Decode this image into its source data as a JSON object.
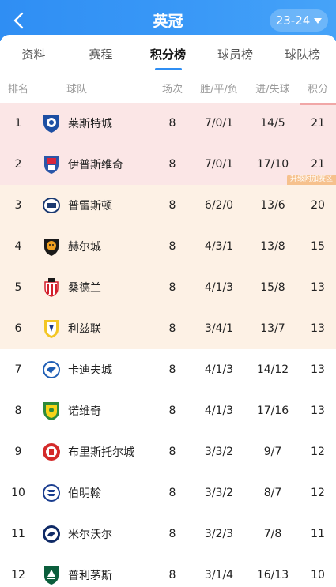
{
  "header": {
    "title": "英冠",
    "season": "23-24"
  },
  "tabs": [
    {
      "label": "资料"
    },
    {
      "label": "赛程"
    },
    {
      "label": "积分榜"
    },
    {
      "label": "球员榜"
    },
    {
      "label": "球队榜"
    }
  ],
  "active_tab": "积分榜",
  "columns": {
    "rank": "排名",
    "team": "球队",
    "played": "场次",
    "wdl": "胜/平/负",
    "goals": "进/失球",
    "points": "积分"
  },
  "zone_label": "升级附加赛区",
  "colors": {
    "header": "#2f8ef3",
    "promotion_zone": "#fbe6e6",
    "playoff_zone": "#fdf1e5",
    "zone_tag": "#f6c18d"
  },
  "rows": [
    {
      "rank": "1",
      "team": "莱斯特城",
      "played": "8",
      "wdl": "7/0/1",
      "goals": "14/5",
      "points": "21",
      "crest": "leicester-crest-icon"
    },
    {
      "rank": "2",
      "team": "伊普斯维奇",
      "played": "8",
      "wdl": "7/0/1",
      "goals": "17/10",
      "points": "21",
      "crest": "ipswich-crest-icon"
    },
    {
      "rank": "3",
      "team": "普雷斯顿",
      "played": "8",
      "wdl": "6/2/0",
      "goals": "13/6",
      "points": "20",
      "crest": "preston-crest-icon"
    },
    {
      "rank": "4",
      "team": "赫尔城",
      "played": "8",
      "wdl": "4/3/1",
      "goals": "13/8",
      "points": "15",
      "crest": "hull-crest-icon"
    },
    {
      "rank": "5",
      "team": "桑德兰",
      "played": "8",
      "wdl": "4/1/3",
      "goals": "15/8",
      "points": "13",
      "crest": "sunderland-crest-icon"
    },
    {
      "rank": "6",
      "team": "利兹联",
      "played": "8",
      "wdl": "3/4/1",
      "goals": "13/7",
      "points": "13",
      "crest": "leeds-crest-icon"
    },
    {
      "rank": "7",
      "team": "卡迪夫城",
      "played": "8",
      "wdl": "4/1/3",
      "goals": "14/12",
      "points": "13",
      "crest": "cardiff-crest-icon"
    },
    {
      "rank": "8",
      "team": "诺维奇",
      "played": "8",
      "wdl": "4/1/3",
      "goals": "17/16",
      "points": "13",
      "crest": "norwich-crest-icon"
    },
    {
      "rank": "9",
      "team": "布里斯托尔城",
      "played": "8",
      "wdl": "3/3/2",
      "goals": "9/7",
      "points": "12",
      "crest": "bristol-crest-icon"
    },
    {
      "rank": "10",
      "team": "伯明翰",
      "played": "8",
      "wdl": "3/3/2",
      "goals": "8/7",
      "points": "12",
      "crest": "birmingham-crest-icon"
    },
    {
      "rank": "11",
      "team": "米尔沃尔",
      "played": "8",
      "wdl": "3/2/3",
      "goals": "7/8",
      "points": "11",
      "crest": "millwall-crest-icon"
    },
    {
      "rank": "12",
      "team": "普利茅斯",
      "played": "8",
      "wdl": "3/1/4",
      "goals": "16/13",
      "points": "10",
      "crest": "plymouth-crest-icon"
    }
  ]
}
